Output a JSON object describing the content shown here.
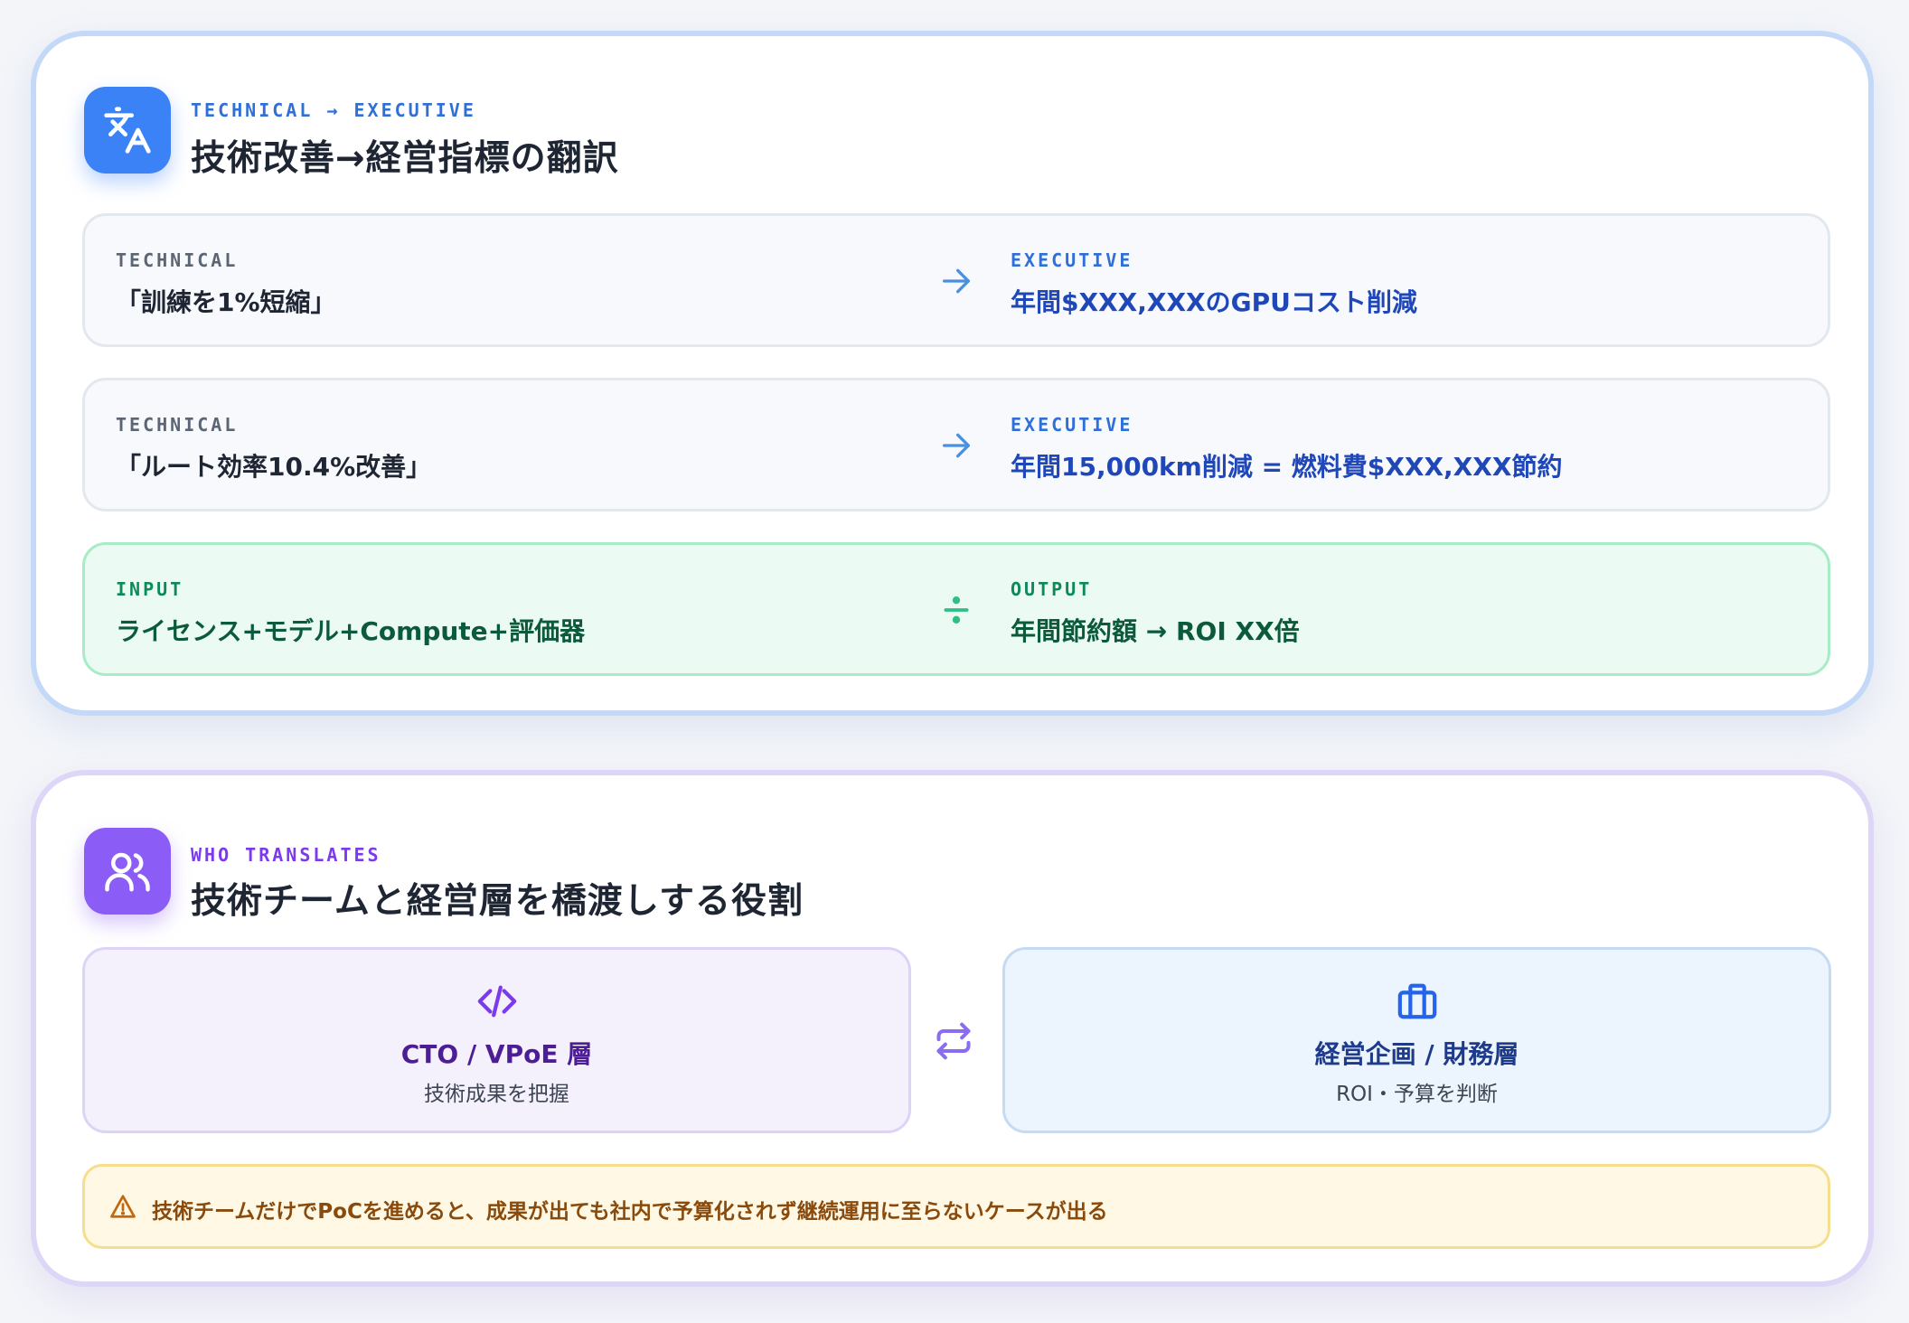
{
  "translation": {
    "icon": "translate-icon",
    "eyebrow": "TECHNICAL → EXECUTIVE",
    "title": "技術改善→経営指標の翻訳",
    "rows": [
      {
        "left_label": "TECHNICAL",
        "left_value": "「訓練を1%短縮」",
        "arrow_icon": "arrow-right-icon",
        "right_label": "EXECUTIVE",
        "right_value": "年間$XXX,XXXのGPUコスト削減"
      },
      {
        "left_label": "TECHNICAL",
        "left_value": "「ルート効率10.4%改善」",
        "arrow_icon": "arrow-right-icon",
        "right_label": "EXECUTIVE",
        "right_value": "年間15,000km削減 = 燃料費$XXX,XXX節約"
      },
      {
        "left_label": "INPUT",
        "left_value": "ライセンス+モデル+Compute+評価器",
        "arrow_icon": "divide-icon",
        "right_label": "OUTPUT",
        "right_value": "年間節約額 → ROI XX倍"
      }
    ]
  },
  "translators": {
    "icon": "users-icon",
    "eyebrow": "WHO TRANSLATES",
    "title": "技術チームと経営層を橋渡しする役割",
    "roles": [
      {
        "icon": "code-icon",
        "name": "CTO / VPoE 層",
        "desc": "技術成果を把握"
      },
      {
        "icon": "briefcase-icon",
        "name": "経営企画 / 財務層",
        "desc": "ROI・予算を判断"
      }
    ],
    "swap_icon": "repeat-icon",
    "warning": {
      "icon": "warning-icon",
      "text": "技術チームだけでPoCを進めると、成果が出ても社内で予算化されず継続運用に至らないケースが出る"
    }
  },
  "colors": {
    "blue_accent": "#3b82f6",
    "purple_accent": "#8b5cf6",
    "executive_text": "#1f47b8",
    "output_green": "#0b5a3c",
    "warning_text": "#8a4a0c"
  }
}
